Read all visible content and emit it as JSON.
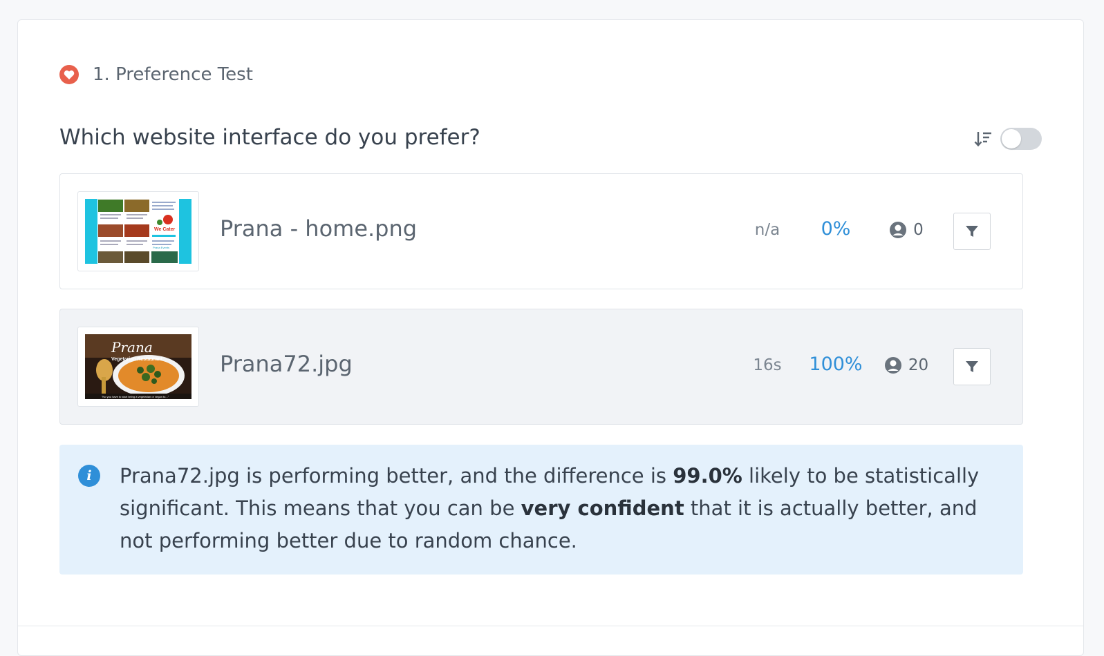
{
  "section": {
    "title": "1. Preference Test",
    "icon": "heart-icon",
    "icon_color": "#e8604c"
  },
  "question": {
    "title": "Which website interface do you prefer?"
  },
  "controls": {
    "sort_icon": "sort-descending-icon",
    "toggle_on": false
  },
  "options": [
    {
      "file_name": "Prana - home.png",
      "time": "n/a",
      "percent": "0%",
      "respondents": "0",
      "selected": false,
      "thumbnail_texts": [
        "We Cater",
        "Prana Events"
      ]
    },
    {
      "file_name": "Prana72.jpg",
      "time": "16s",
      "percent": "100%",
      "respondents": "20",
      "selected": true,
      "thumbnail_texts": [
        "Prana",
        "Vegetarian Restaurant",
        "\"No you have to start being a vegetarian or vegan to...\""
      ]
    }
  ],
  "info": {
    "icon": "info-icon",
    "part1": "Prana72.jpg is performing better, and the difference is ",
    "bold1": "99.0%",
    "part2": " likely to be statistically significant. This means that you can be ",
    "bold2": "very confident",
    "part3": " that it is actually better, and not performing better due to random chance."
  },
  "colors": {
    "accent": "#2f8fd8",
    "info_bg": "#e4f1fc",
    "selected_row_bg": "#f1f3f6"
  }
}
